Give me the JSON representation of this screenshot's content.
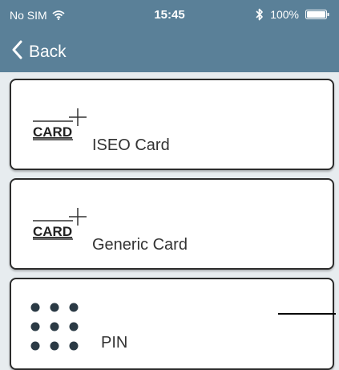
{
  "status_bar": {
    "carrier": "No SIM",
    "time": "15:45",
    "battery": "100%"
  },
  "nav": {
    "back_label": "Back"
  },
  "options": [
    {
      "icon_text": "CARD",
      "label": "ISEO Card",
      "icon": "card-plus-icon"
    },
    {
      "icon_text": "CARD",
      "label": "Generic Card",
      "icon": "card-plus-icon"
    },
    {
      "label": "PIN",
      "icon": "keypad-dots-icon"
    }
  ],
  "colors": {
    "header": "#5a8098",
    "background": "#e7ecef",
    "card_border": "#2c2c2c"
  }
}
